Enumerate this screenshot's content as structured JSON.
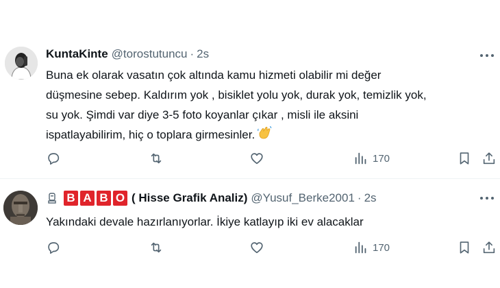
{
  "tweets": [
    {
      "name": "KuntaKinte",
      "handle": "@torostutuncu",
      "dot": "·",
      "time": "2s",
      "text_lines": [
        "Buna ek olarak vasatın çok altında kamu hizmeti olabilir mi değer",
        "düşmesine sebep. Kaldırım yok , bisiklet yolu yok, durak yok, temizlik yok,",
        "su yok. Şimdi var diye 3-5 foto koyanlar çıkar , misli ile aksini",
        "ispatlayabilirim, hiç o toplara girmesinler."
      ],
      "emoji_icon": "waving-hands-icon",
      "views": "170"
    },
    {
      "badge_icon": "statue-icon",
      "name_badge_letters": [
        "B",
        "A",
        "B",
        "O"
      ],
      "name_badge_color": "#e0242b",
      "name": "( Hisse Grafik Analiz)",
      "handle": "@Yusuf_Berke2001",
      "dot": "·",
      "time": "2s",
      "text_lines": [
        "Yakındaki devale hazırlanıyorlar. İkiye katlayıp iki ev alacaklar"
      ],
      "views": "170"
    }
  ],
  "icons": {
    "reply": "reply-icon",
    "retweet": "retweet-icon",
    "like": "heart-icon",
    "views": "views-icon",
    "bookmark": "bookmark-icon",
    "share": "share-icon",
    "more": "more-icon"
  },
  "colors": {
    "text": "#0f1419",
    "secondary": "#536471",
    "divider": "#eff3f4",
    "badge_red": "#e0242b"
  }
}
